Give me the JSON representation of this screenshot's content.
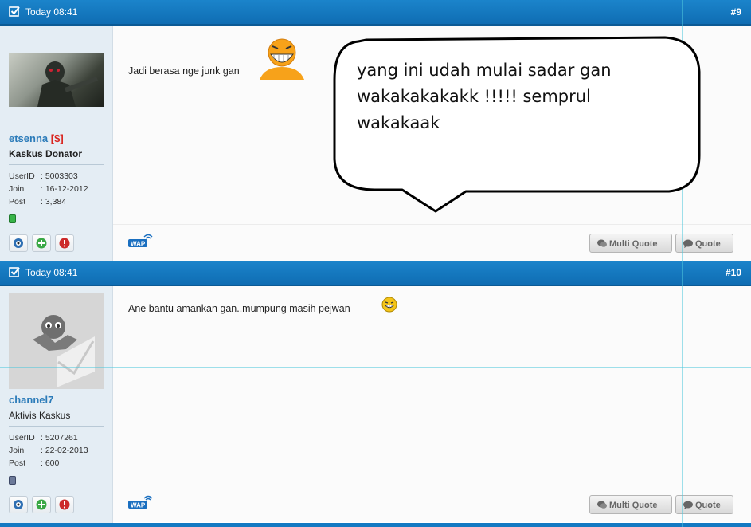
{
  "posts": [
    {
      "date": "Today 08:41",
      "number": "#9",
      "username": "etsenna",
      "donator_mark": "[$]",
      "user_title": "Kaskus Donator",
      "userid_label": "UserID",
      "userid_value": ": 5003303",
      "join_label": "Join",
      "join_value": ": 16-12-2012",
      "post_label": "Post",
      "post_value": ": 3,384",
      "message": "Jadi berasa nge junk gan",
      "status_color": "#38b449"
    },
    {
      "date": "Today 08:41",
      "number": "#10",
      "username": "channel7",
      "user_title": "Aktivis Kaskus",
      "userid_label": "UserID",
      "userid_value": ": 5207261",
      "join_label": "Join",
      "join_value": ": 22-02-2013",
      "post_label": "Post",
      "post_value": ": 600",
      "message": "Ane bantu amankan gan..mumpung masih pejwan",
      "status_color": "#6c7a99"
    }
  ],
  "buttons": {
    "multi_quote": "Multi Quote",
    "quote": "Quote"
  },
  "wap_label": "WAP",
  "speech_bubble": "yang ini udah mulai sadar gan\nwakakakakakk !!!!! semprul\nwakakaak",
  "colors": {
    "header_blue": "#1379c2",
    "sidebar_bg": "#e4edf4",
    "username_blue": "#2b7bb9",
    "donator_red": "#d9231d"
  }
}
